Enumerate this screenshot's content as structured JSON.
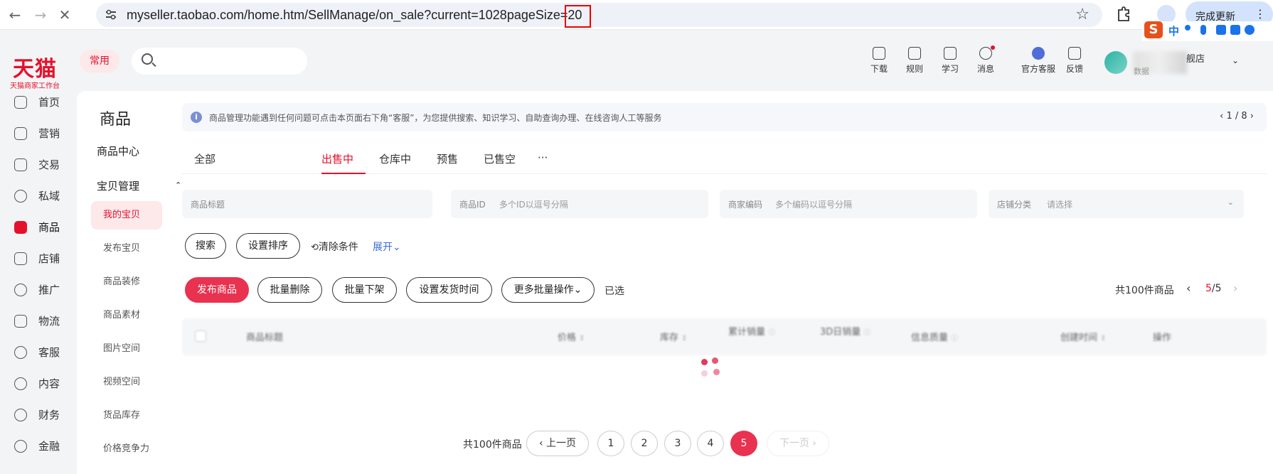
{
  "browser": {
    "url": "myseller.taobao.com/home.htm/SellManage/on_sale?current=1028pageSize=20",
    "update_label": "完成更新",
    "ime_logo": "S",
    "ime_lang": "中"
  },
  "header": {
    "logo": "天猫",
    "logo_sub": "天猫商家工作台",
    "common_tag": "常用",
    "search_placeholder": "",
    "tools": [
      {
        "label": "下载",
        "icon": "download-icon"
      },
      {
        "label": "规则",
        "icon": "rules-icon"
      },
      {
        "label": "学习",
        "icon": "learn-icon"
      },
      {
        "label": "消息",
        "icon": "message-icon"
      },
      {
        "label": "官方客服",
        "icon": "official-service-icon"
      },
      {
        "label": "反馈",
        "icon": "feedback-icon"
      }
    ],
    "shop_name": "舰店",
    "shop_sub": "数据"
  },
  "leftnav": [
    {
      "label": "首页",
      "icon": "home-icon"
    },
    {
      "label": "营销",
      "icon": "megaphone-icon"
    },
    {
      "label": "交易",
      "icon": "trade-icon"
    },
    {
      "label": "私域",
      "icon": "users-icon"
    },
    {
      "label": "商品",
      "icon": "goods-icon",
      "active": true
    },
    {
      "label": "店铺",
      "icon": "shop-icon"
    },
    {
      "label": "推广",
      "icon": "promotion-icon"
    },
    {
      "label": "物流",
      "icon": "logistics-icon"
    },
    {
      "label": "客服",
      "icon": "headset-icon"
    },
    {
      "label": "内容",
      "icon": "content-icon"
    },
    {
      "label": "财务",
      "icon": "finance-icon"
    },
    {
      "label": "金融",
      "icon": "banking-icon"
    }
  ],
  "subnav": {
    "title": "商品",
    "center": "商品中心",
    "group": "宝贝管理",
    "group_caret": "⌃",
    "items": [
      "我的宝贝",
      "发布宝贝",
      "商品装修",
      "商品素材",
      "图片空间",
      "视频空间",
      "货品库存",
      "价格竞争力"
    ]
  },
  "notice": {
    "icon": "i",
    "text": "商品管理功能遇到任何问题可点击本页面右下角“客服”，为您提供搜索、知识学习、自助查询办理、在线咨询人工等服务",
    "pager": "‹ 1 / 8 ›"
  },
  "tabs": [
    "全部",
    "出售中",
    "仓库中",
    "预售",
    "已售空",
    "···"
  ],
  "filters": {
    "title_placeholder": "商品标题",
    "id_label": "商品ID",
    "id_placeholder": "多个ID以逗号分隔",
    "code_label": "商家编码",
    "code_placeholder": "多个编码以逗号分隔",
    "category_label": "店铺分类",
    "category_placeholder": "请选择",
    "category_caret": "⌄"
  },
  "actions": {
    "search": "搜索",
    "sort": "设置排序",
    "clear": "清除条件",
    "expand": "展开⌄"
  },
  "batch": {
    "publish": "发布商品",
    "delete": "批量删除",
    "offshelf": "批量下架",
    "ship_time": "设置发货时间",
    "more": "更多批量操作⌄",
    "selected": "已选",
    "total": "共100件商品",
    "prev": "‹",
    "page_current": "5",
    "page_total": "/5",
    "next": "›"
  },
  "table": {
    "headers": [
      "商品标题",
      "价格",
      "库存",
      "累计销量",
      "3D日销量",
      "信息质量",
      "创建时间",
      "操作"
    ],
    "sort_mark": "↕"
  },
  "pagination": {
    "total": "共100件商品",
    "prev": "‹ 上一页",
    "pages": [
      "1",
      "2",
      "3",
      "4",
      "5"
    ],
    "current": "5",
    "next": "下一页 ›"
  }
}
